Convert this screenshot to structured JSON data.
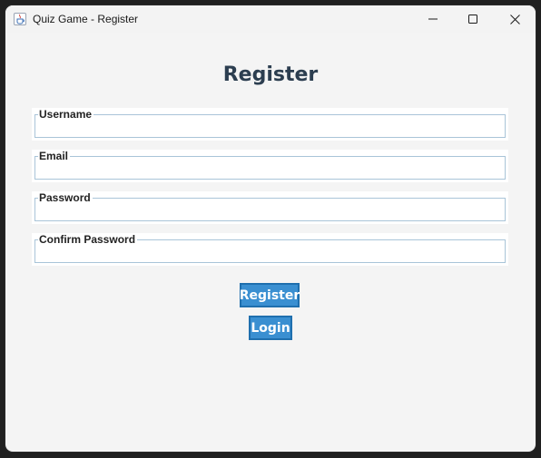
{
  "window": {
    "title": "Quiz Game - Register",
    "icon": "java-cup-icon",
    "controls": [
      "minimize-icon",
      "maximize-icon",
      "close-icon"
    ]
  },
  "form": {
    "heading": "Register",
    "fields": [
      {
        "label": "Username",
        "value": "",
        "type": "text"
      },
      {
        "label": "Email",
        "value": "",
        "type": "text"
      },
      {
        "label": "Password",
        "value": "",
        "type": "password"
      },
      {
        "label": "Confirm Password",
        "value": "",
        "type": "password"
      }
    ],
    "register_button": "Register",
    "login_button": "Login"
  },
  "colors": {
    "heading": "#2c3e50",
    "button_fill": "#3a8fd1",
    "button_border": "#1f6fae",
    "field_border": "#a9c4d8",
    "background": "#f4f4f4"
  }
}
